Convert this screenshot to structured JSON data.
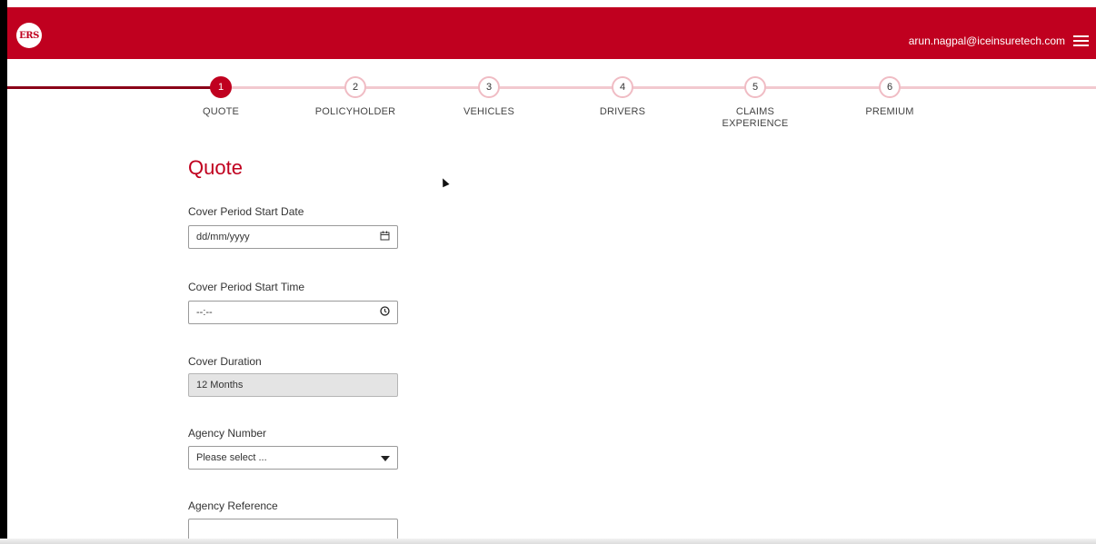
{
  "header": {
    "logo_text": "ERS",
    "user_email": "arun.nagpal@iceinsuretech.com",
    "menu_icon": "hamburger-menu-icon",
    "brand_color": "#c0001f"
  },
  "steps": [
    {
      "number": "1",
      "label": "QUOTE",
      "active": true
    },
    {
      "number": "2",
      "label": "POLICYHOLDER",
      "active": false
    },
    {
      "number": "3",
      "label": "VEHICLES",
      "active": false
    },
    {
      "number": "4",
      "label": "DRIVERS",
      "active": false
    },
    {
      "number": "5",
      "label": "CLAIMS\nEXPERIENCE",
      "active": false
    },
    {
      "number": "6",
      "label": "PREMIUM",
      "active": false
    }
  ],
  "form": {
    "title": "Quote",
    "start_date": {
      "label": "Cover Period Start Date",
      "value": "dd/mm/yyyy",
      "icon": "calendar-icon"
    },
    "start_time": {
      "label": "Cover Period Start Time",
      "value": "--:--",
      "icon": "clock-icon"
    },
    "duration": {
      "label": "Cover Duration",
      "value": "12 Months"
    },
    "agency_number": {
      "label": "Agency Number",
      "value": "Please select ..."
    },
    "agency_reference": {
      "label": "Agency Reference",
      "value": ""
    }
  }
}
